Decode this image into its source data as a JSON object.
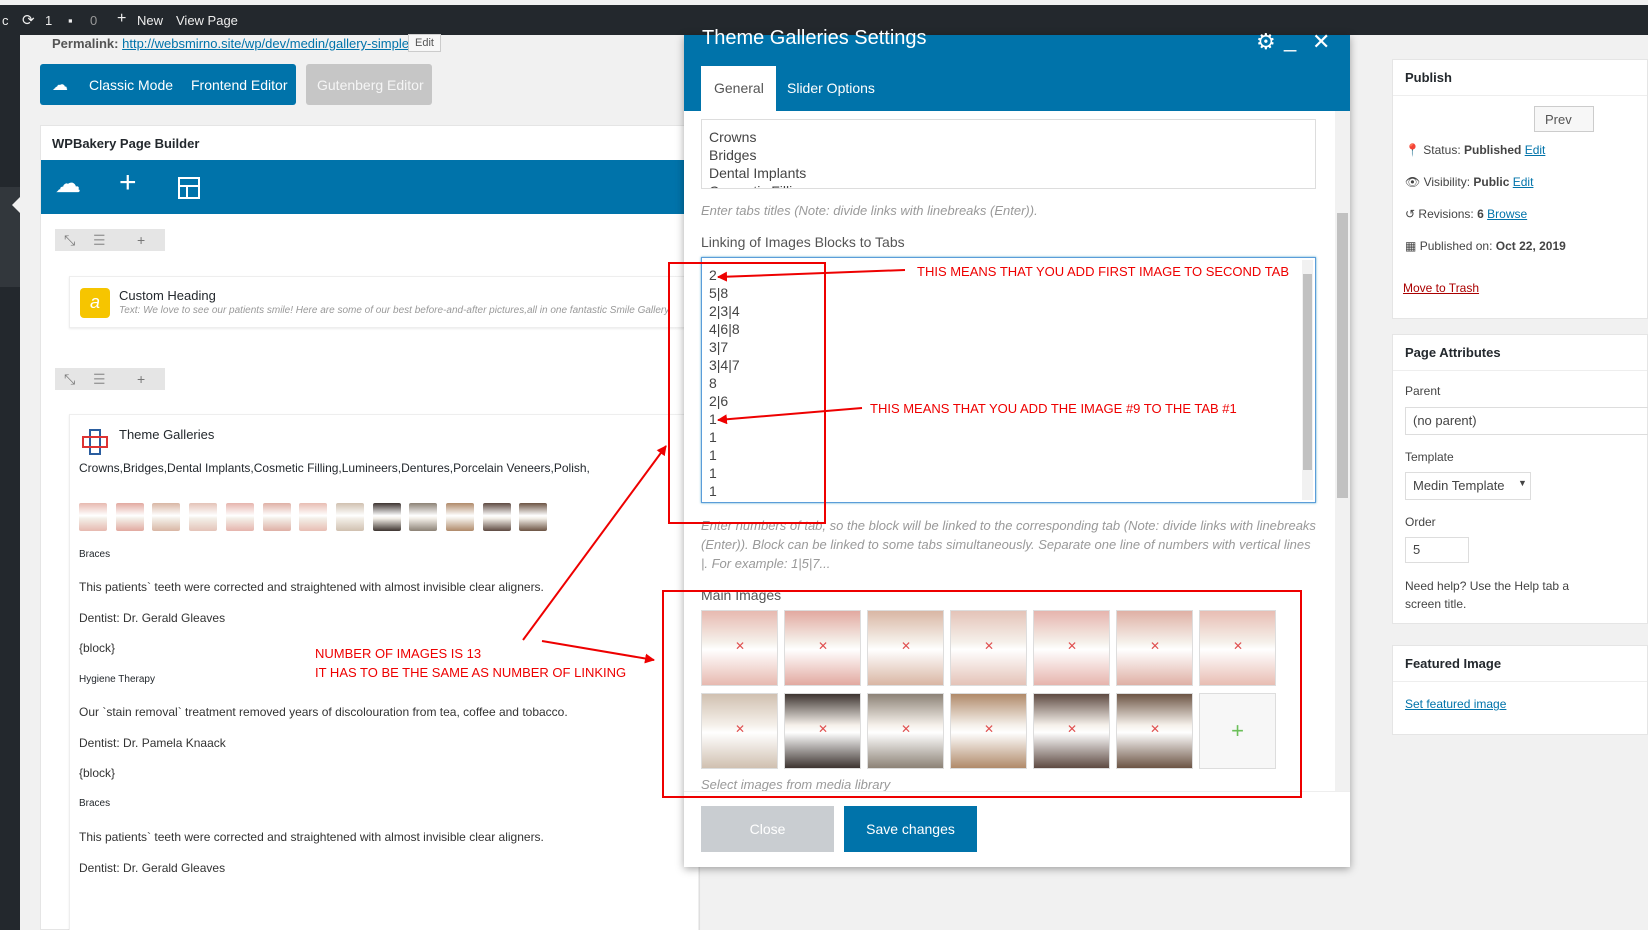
{
  "adminbar": {
    "site_char": "c",
    "updates_count": "1",
    "comments_count": "0",
    "new_label": "New",
    "view_page_label": "View Page"
  },
  "permalink": {
    "label": "Permalink:",
    "url": "http://websmirno.site/wp/dev/medin/gallery-simple/",
    "edit_label": "Edit"
  },
  "editor_modes": {
    "classic": "Classic Mode",
    "frontend": "Frontend Editor",
    "gutenberg": "Gutenberg Editor"
  },
  "builder": {
    "title": "WPBakery Page Builder",
    "custom_heading": {
      "title": "Custom Heading",
      "text": "Text: We love to see our patients smile! Here are some of our best before-and-after pictures,all in one fantastic Smile Gallery"
    },
    "gallery": {
      "title": "Theme Galleries",
      "tabs_line": "Crowns,Bridges,Dental Implants,Cosmetic Filling,Lumineers,Dentures,Porcelain Veneers,Polish,",
      "thumb_count": 13,
      "blocks": [
        {
          "heading": "Braces",
          "text": "This patients` teeth were corrected and straightened with almost invisible clear aligners.",
          "dentist_label": "Dentist:",
          "dentist": "Dr. Gerald Gleaves",
          "block": "{block}"
        },
        {
          "heading": "Hygiene Therapy",
          "text": "Our `stain removal` treatment removed years of discolouration from tea, coffee and tobacco.",
          "dentist_label": "Dentist:",
          "dentist": "Dr. Pamela Knaack",
          "block": "{block}"
        },
        {
          "heading": "Braces",
          "text": "This patients` teeth were corrected and straightened with almost invisible clear aligners.",
          "dentist_label": "Dentist:",
          "dentist": "Dr. Gerald Gleaves"
        }
      ]
    }
  },
  "modal": {
    "title": "Theme Galleries Settings",
    "tabs": [
      "General",
      "Slider Options"
    ],
    "tab_titles_textarea": [
      "Crowns",
      "Bridges",
      "Dental Implants",
      "Cosmetic Filling"
    ],
    "tab_titles_hint": "Enter tabs titles (Note: divide links with linebreaks (Enter)).",
    "linking_label": "Linking of Images Blocks to Tabs",
    "linking_values": [
      "2",
      "5|8",
      "2|3|4",
      "4|6|8",
      "3|7",
      "3|4|7",
      "8",
      "2|6",
      "1",
      "1",
      "1",
      "1",
      "1"
    ],
    "linking_hint": "Enter numbers of tab, so the block will be linked to the corresponding tab (Note: divide links with linebreaks (Enter)). Block can be linked to some tabs simultaneously. Separate one line of numbers with vertical lines |. For example: 1|5|7...",
    "main_images_label": "Main Images",
    "main_images_hint": "Select images from media library",
    "image_count": 13,
    "close_label": "Close",
    "save_label": "Save changes"
  },
  "sidebar": {
    "publish": {
      "title": "Publish",
      "preview_label": "Prev",
      "status_label": "Status:",
      "status_value": "Published",
      "visibility_label": "Visibility:",
      "visibility_value": "Public",
      "revisions_label": "Revisions:",
      "revisions_value": "6",
      "browse_label": "Browse",
      "published_label": "Published on:",
      "published_value": "Oct 22, 2019",
      "edit_label": "Edit",
      "trash_label": "Move to Trash"
    },
    "attributes": {
      "title": "Page Attributes",
      "parent_label": "Parent",
      "parent_value": "(no parent)",
      "template_label": "Template",
      "template_value": "Medin Template",
      "order_label": "Order",
      "order_value": "5",
      "help_text_1": "Need help? Use the Help tab a",
      "help_text_2": "screen title."
    },
    "featured": {
      "title": "Featured Image",
      "set_label": "Set featured image"
    }
  },
  "annotations": {
    "first": "THIS MEANS THAT YOU ADD FIRST IMAGE TO SECOND TAB",
    "ninth": "THIS MEANS THAT YOU ADD THE IMAGE #9 TO THE TAB #1",
    "count_line1": "NUMBER OF IMAGES IS 13",
    "count_line2": "IT HAS TO BE THE SAME AS NUMBER OF LINKING"
  },
  "colors": {
    "wp_blue": "#0073aa",
    "admin_dark": "#23282d",
    "annotation_red": "#e00000"
  }
}
